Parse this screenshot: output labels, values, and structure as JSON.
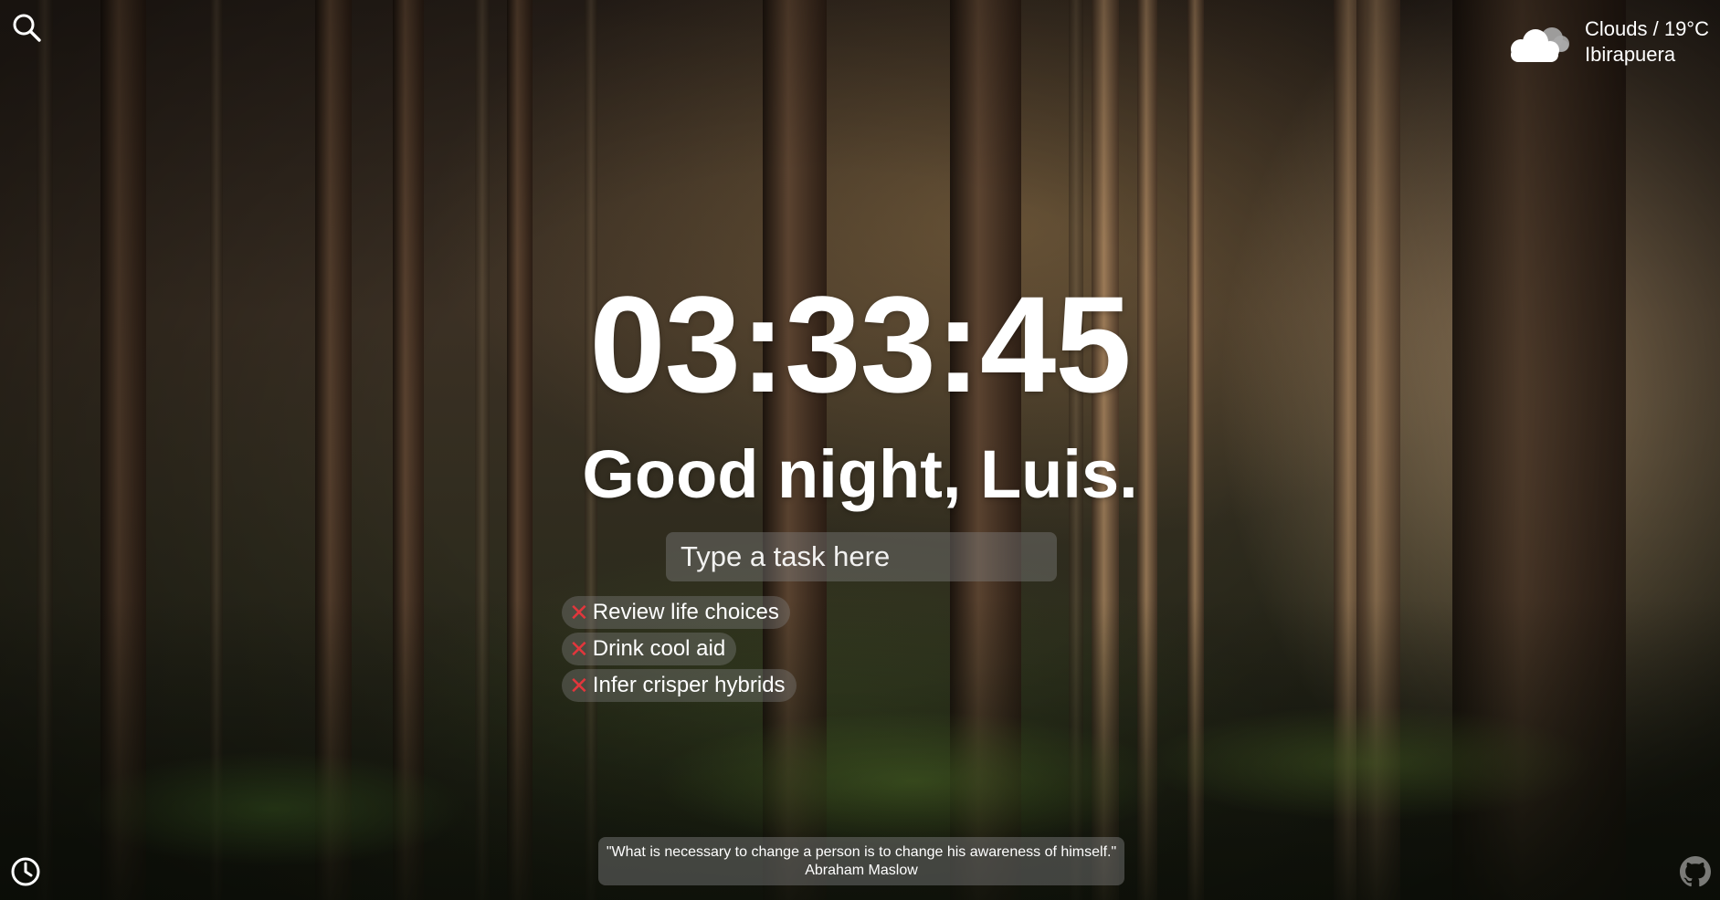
{
  "clock": {
    "time": "03:33:45"
  },
  "greeting": {
    "text": "Good night, Luis."
  },
  "task_input": {
    "placeholder": "Type a task here",
    "value": ""
  },
  "tasks": [
    {
      "label": "Review life choices",
      "remove_icon": "red-x-icon"
    },
    {
      "label": "Drink cool aid",
      "remove_icon": "red-x-icon"
    },
    {
      "label": "Infer crisper hybrids",
      "remove_icon": "red-x-icon"
    }
  ],
  "weather": {
    "condition_line": "Clouds / 19°C",
    "location": "Ibirapuera",
    "icon": "cloud-icon"
  },
  "quote": {
    "text": "\"What is necessary to change a person is to change his awareness of himself.\"",
    "author": "Abraham Maslow"
  },
  "icons": {
    "search": "search-icon",
    "history": "clock-icon",
    "github": "github-icon"
  },
  "colors": {
    "text": "#ffffff",
    "remove_x": "#e2363c",
    "panel_bg": "rgba(128,128,128,0.42)"
  }
}
